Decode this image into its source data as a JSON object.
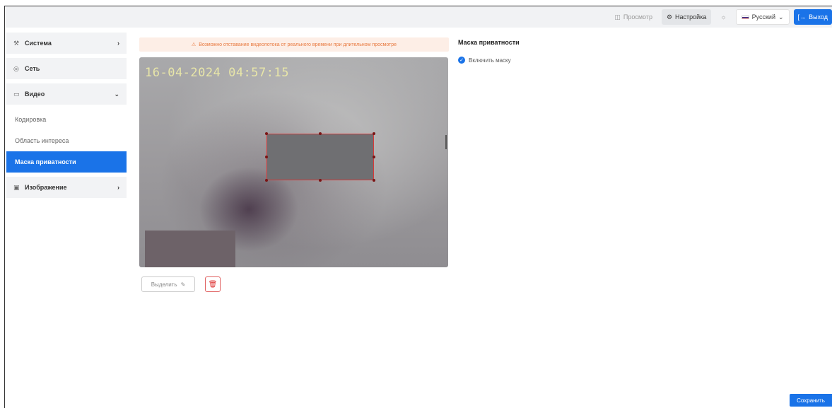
{
  "topbar": {
    "view_label": "Просмотр",
    "view_icon": "camera-icon",
    "settings_label": "Настройка",
    "settings_icon": "gear-icon",
    "brightness_icon": "sun-icon",
    "language_label": "Русский",
    "logout_label": "Выход"
  },
  "sidebar": {
    "items": [
      {
        "label": "Система",
        "icon": "wrench-icon",
        "chevron": "›"
      },
      {
        "label": "Сеть",
        "icon": "globe-icon",
        "chevron": ""
      },
      {
        "label": "Видео",
        "icon": "video-icon",
        "chevron": "⌄"
      },
      {
        "label": "Изображение",
        "icon": "image-icon",
        "chevron": "›"
      }
    ],
    "video_subitems": [
      {
        "label": "Кодировка"
      },
      {
        "label": "Область интереса"
      },
      {
        "label": "Маска приватности"
      }
    ]
  },
  "warning": {
    "text": "Возможно отставание видеопотока от реального времени при длительном просмотре",
    "icon": "warning-icon"
  },
  "video": {
    "timestamp": "16-04-2024 04:57:15"
  },
  "controls": {
    "select_label": "Выделить",
    "select_icon": "pencil-icon",
    "delete_icon": "trash-icon"
  },
  "panel": {
    "title": "Маска приватности",
    "enable_mask_label": "Включить маску",
    "enable_mask_checked": true
  },
  "footer": {
    "save_label": "Сохранить"
  },
  "colors": {
    "accent": "#1a73e8",
    "warning_bg": "#fdeee6",
    "warning_text": "#e87a40",
    "mask_border": "#d63a3a"
  }
}
